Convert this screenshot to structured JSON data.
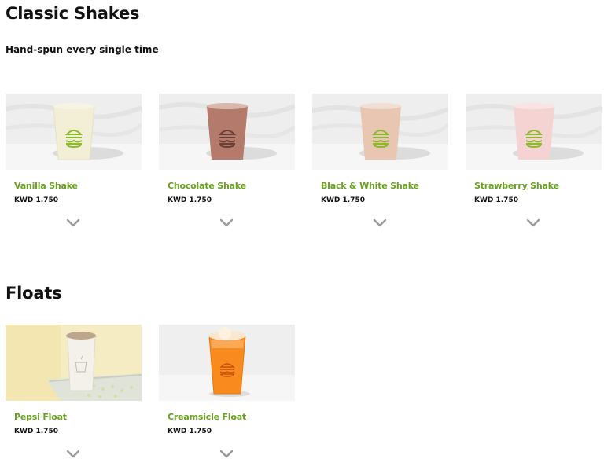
{
  "sections": [
    {
      "title": "Classic Shakes",
      "subtitle": "Hand-spun every single time",
      "items": [
        {
          "name": "Vanilla Shake",
          "price": "KWD 1.750",
          "image": "vanilla-shake-image",
          "drink_color": "#f3efd6"
        },
        {
          "name": "Chocolate Shake",
          "price": "KWD 1.750",
          "image": "chocolate-shake-image",
          "drink_color": "#b47a6c"
        },
        {
          "name": "Black & White Shake",
          "price": "KWD 1.750",
          "image": "black-white-shake-image",
          "drink_color": "#e8c6b2"
        },
        {
          "name": "Strawberry Shake",
          "price": "KWD 1.750",
          "image": "strawberry-shake-image",
          "drink_color": "#f6d3d3"
        }
      ]
    },
    {
      "title": "Floats",
      "items": [
        {
          "name": "Pepsi Float",
          "price": "KWD 1.750",
          "image": "pepsi-float-image",
          "drink_color": "#f4f1ea"
        },
        {
          "name": "Creamsicle Float",
          "price": "KWD 1.750",
          "image": "creamsicle-float-image",
          "drink_color": "#f98a1d"
        }
      ]
    }
  ],
  "colors": {
    "item_name": "#6aa121",
    "logo_green": "#8bbb2c",
    "chevron": "#9a9a9a"
  },
  "icons": {
    "expand": "chevron-down-icon",
    "logo": "burger-logo-icon"
  }
}
